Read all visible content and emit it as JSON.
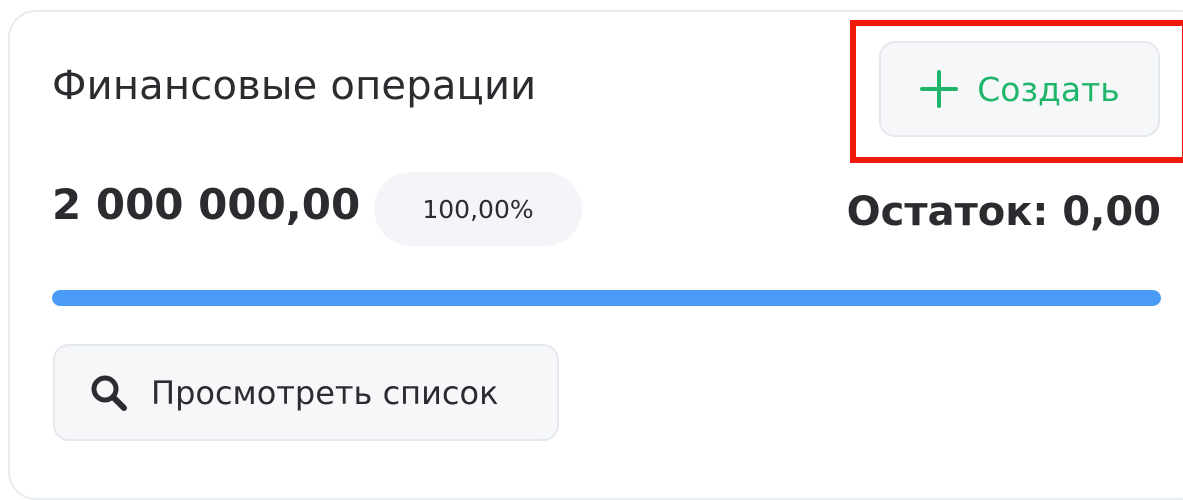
{
  "header": {
    "title": "Финансовые операции"
  },
  "actions": {
    "create_label": "Создать",
    "create_icon": "plus-icon",
    "view_list_label": "Просмотреть список",
    "view_list_icon": "search-icon"
  },
  "summary": {
    "amount": "2 000 000,00",
    "percent": "100,00%",
    "remainder": "Остаток: 0,00",
    "progress_fraction": 1.0
  },
  "colors": {
    "accent_green": "#1fb56a",
    "progress_blue": "#4a9bf5",
    "highlight_red": "#f01a0c",
    "text_dark": "#2b2b30"
  }
}
